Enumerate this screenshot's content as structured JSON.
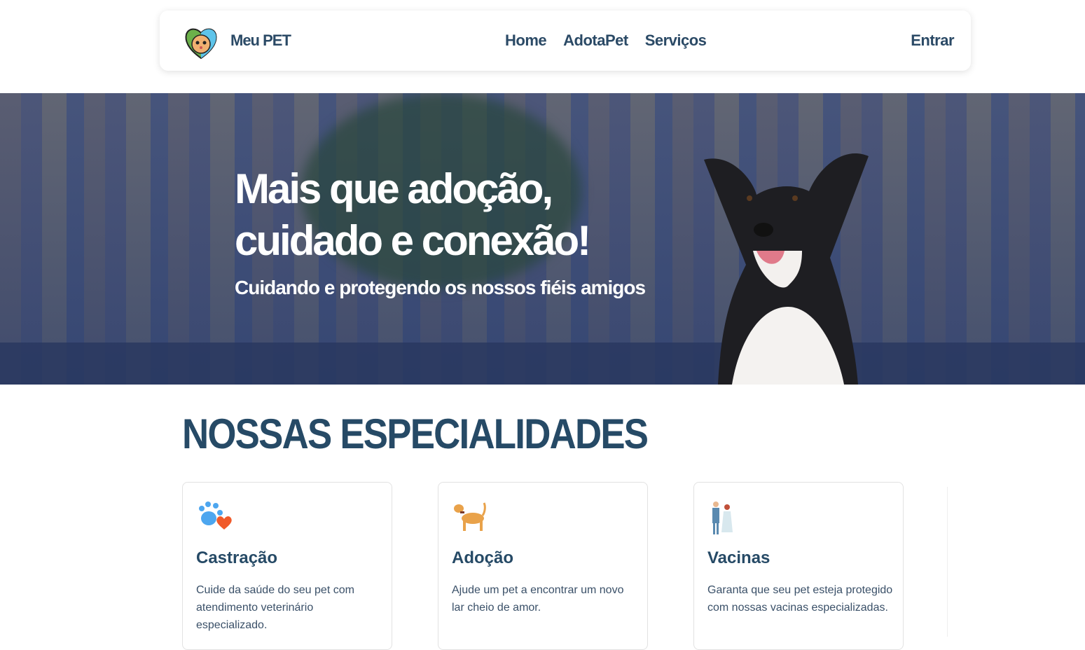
{
  "nav": {
    "brand": "Meu PET",
    "links": [
      "Home",
      "AdotaPet",
      "Serviços"
    ],
    "login": "Entrar"
  },
  "hero": {
    "title_line1": "Mais que adoção,",
    "title_line2": "cuidado e conexão!",
    "subtitle": "Cuidando e protegendo os nossos fiéis amigos"
  },
  "section": {
    "title": "NOSSAS ESPECIALIDADES"
  },
  "cards": [
    {
      "icon": "paw-heart-icon",
      "title": "Castração",
      "text": "Cuide da saúde do seu pet com atendimento veterinário especializado."
    },
    {
      "icon": "dog-icon",
      "title": "Adoção",
      "text": "Ajude um pet a encontrar um novo lar cheio de amor."
    },
    {
      "icon": "couple-icon",
      "title": "Vacinas",
      "text": "Garanta que seu pet esteja protegido com nossas vacinas especializadas."
    }
  ]
}
